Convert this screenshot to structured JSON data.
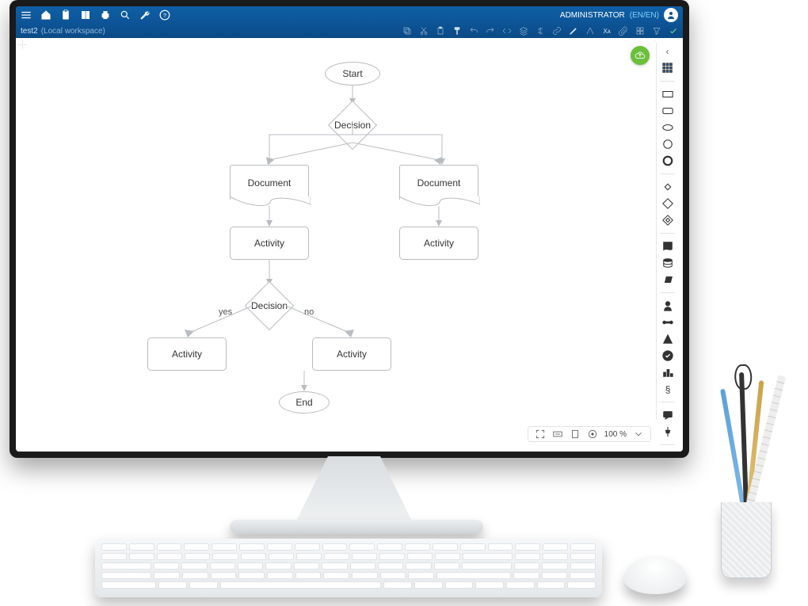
{
  "header": {
    "admin_label": "ADMINISTRATOR",
    "language": "(EN/EN)"
  },
  "breadcrumb": {
    "doc_name": "test2",
    "workspace": "(Local workspace)"
  },
  "flowchart": {
    "start": "Start",
    "decision1": "Decision",
    "doc_left": "Document",
    "doc_right": "Document",
    "act_left": "Activity",
    "act_right": "Activity",
    "decision2": "Decision",
    "edge_yes": "yes",
    "edge_no": "no",
    "act_bl": "Activity",
    "act_br": "Activity",
    "end": "End"
  },
  "zoom": {
    "value": "100 %"
  }
}
